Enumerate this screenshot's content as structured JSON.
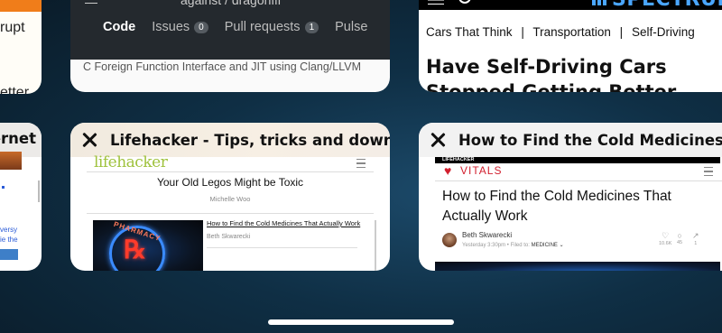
{
  "top_left_card": {
    "text_1": "rupt",
    "text_2": "etter"
  },
  "github_card": {
    "title_partial": "against / dragonffi",
    "tabs": [
      {
        "label": "Code"
      },
      {
        "label": "Issues",
        "count": "0"
      },
      {
        "label": "Pull requests",
        "count": "1"
      },
      {
        "label": "Pulse"
      }
    ],
    "description": "C Foreign Function Interface and JIT using Clang/LLVM"
  },
  "spectrum_card": {
    "logo": "SPECTRUM",
    "breadcrumb": [
      "Cars That Think",
      "Transportation",
      "Self-Driving"
    ],
    "separator": "|",
    "headline_line1": "Have Self-Driving Cars",
    "headline_line2": "Stopped Getting Better"
  },
  "left_partial_card": {
    "title": "ernet",
    "link_1": "versy",
    "link_2": "ie the"
  },
  "lifehacker_card": {
    "title": "Lifehacker - Tips, tricks and downl...",
    "logo": "lifehacker",
    "headline": "Your Old Legos Might be Toxic",
    "byline": "Michelle Woo",
    "story_link": "How to Find the Cold Medicines That Actually Work",
    "story_author": "Beth Skwarecki",
    "neon_text": "PHARMACY",
    "neon_symbol": "℞"
  },
  "vitals_card": {
    "title": "How to Find the Cold Medicines That Actually Work",
    "tag": "LIFEHACKER",
    "brand": "VITALS",
    "headline_line1": "How to Find the Cold Medicines That",
    "headline_line2": "Actually Work",
    "author": "Beth Skwarecki",
    "meta_prefix": "Yesterday 3:30pm  •  Filed to:",
    "category": "MEDICINE ⌄",
    "stats": [
      {
        "icon": "like-icon",
        "value": "10.6K"
      },
      {
        "icon": "comment-icon",
        "value": "45"
      },
      {
        "icon": "share-icon",
        "value": "1"
      }
    ]
  },
  "colors": {
    "lifehacker_green": "#9fc23d",
    "vitals_red": "#d2202f",
    "github_dark": "#2b3137",
    "spectrum_blue": "#1d5aa8"
  }
}
